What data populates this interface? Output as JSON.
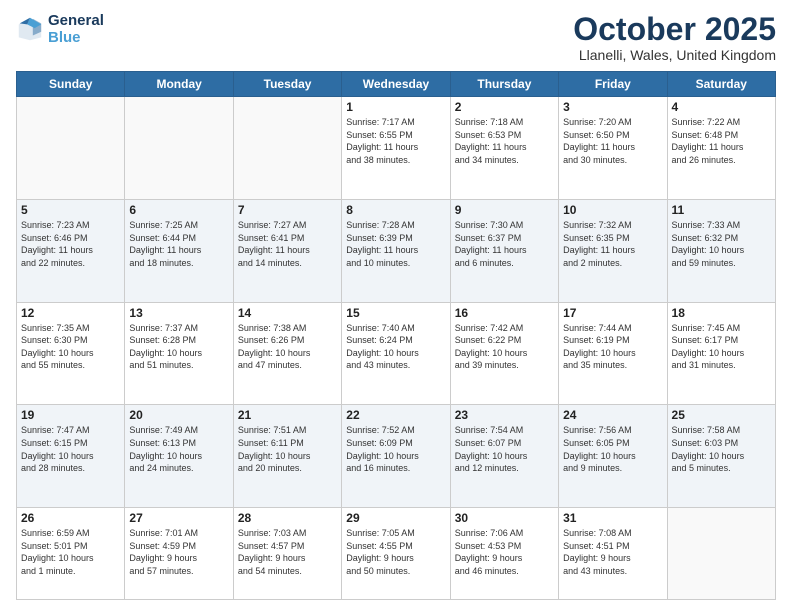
{
  "header": {
    "logo_line1": "General",
    "logo_line2": "Blue",
    "month": "October 2025",
    "location": "Llanelli, Wales, United Kingdom"
  },
  "weekdays": [
    "Sunday",
    "Monday",
    "Tuesday",
    "Wednesday",
    "Thursday",
    "Friday",
    "Saturday"
  ],
  "weeks": [
    [
      {
        "day": "",
        "info": ""
      },
      {
        "day": "",
        "info": ""
      },
      {
        "day": "",
        "info": ""
      },
      {
        "day": "1",
        "info": "Sunrise: 7:17 AM\nSunset: 6:55 PM\nDaylight: 11 hours\nand 38 minutes."
      },
      {
        "day": "2",
        "info": "Sunrise: 7:18 AM\nSunset: 6:53 PM\nDaylight: 11 hours\nand 34 minutes."
      },
      {
        "day": "3",
        "info": "Sunrise: 7:20 AM\nSunset: 6:50 PM\nDaylight: 11 hours\nand 30 minutes."
      },
      {
        "day": "4",
        "info": "Sunrise: 7:22 AM\nSunset: 6:48 PM\nDaylight: 11 hours\nand 26 minutes."
      }
    ],
    [
      {
        "day": "5",
        "info": "Sunrise: 7:23 AM\nSunset: 6:46 PM\nDaylight: 11 hours\nand 22 minutes."
      },
      {
        "day": "6",
        "info": "Sunrise: 7:25 AM\nSunset: 6:44 PM\nDaylight: 11 hours\nand 18 minutes."
      },
      {
        "day": "7",
        "info": "Sunrise: 7:27 AM\nSunset: 6:41 PM\nDaylight: 11 hours\nand 14 minutes."
      },
      {
        "day": "8",
        "info": "Sunrise: 7:28 AM\nSunset: 6:39 PM\nDaylight: 11 hours\nand 10 minutes."
      },
      {
        "day": "9",
        "info": "Sunrise: 7:30 AM\nSunset: 6:37 PM\nDaylight: 11 hours\nand 6 minutes."
      },
      {
        "day": "10",
        "info": "Sunrise: 7:32 AM\nSunset: 6:35 PM\nDaylight: 11 hours\nand 2 minutes."
      },
      {
        "day": "11",
        "info": "Sunrise: 7:33 AM\nSunset: 6:32 PM\nDaylight: 10 hours\nand 59 minutes."
      }
    ],
    [
      {
        "day": "12",
        "info": "Sunrise: 7:35 AM\nSunset: 6:30 PM\nDaylight: 10 hours\nand 55 minutes."
      },
      {
        "day": "13",
        "info": "Sunrise: 7:37 AM\nSunset: 6:28 PM\nDaylight: 10 hours\nand 51 minutes."
      },
      {
        "day": "14",
        "info": "Sunrise: 7:38 AM\nSunset: 6:26 PM\nDaylight: 10 hours\nand 47 minutes."
      },
      {
        "day": "15",
        "info": "Sunrise: 7:40 AM\nSunset: 6:24 PM\nDaylight: 10 hours\nand 43 minutes."
      },
      {
        "day": "16",
        "info": "Sunrise: 7:42 AM\nSunset: 6:22 PM\nDaylight: 10 hours\nand 39 minutes."
      },
      {
        "day": "17",
        "info": "Sunrise: 7:44 AM\nSunset: 6:19 PM\nDaylight: 10 hours\nand 35 minutes."
      },
      {
        "day": "18",
        "info": "Sunrise: 7:45 AM\nSunset: 6:17 PM\nDaylight: 10 hours\nand 31 minutes."
      }
    ],
    [
      {
        "day": "19",
        "info": "Sunrise: 7:47 AM\nSunset: 6:15 PM\nDaylight: 10 hours\nand 28 minutes."
      },
      {
        "day": "20",
        "info": "Sunrise: 7:49 AM\nSunset: 6:13 PM\nDaylight: 10 hours\nand 24 minutes."
      },
      {
        "day": "21",
        "info": "Sunrise: 7:51 AM\nSunset: 6:11 PM\nDaylight: 10 hours\nand 20 minutes."
      },
      {
        "day": "22",
        "info": "Sunrise: 7:52 AM\nSunset: 6:09 PM\nDaylight: 10 hours\nand 16 minutes."
      },
      {
        "day": "23",
        "info": "Sunrise: 7:54 AM\nSunset: 6:07 PM\nDaylight: 10 hours\nand 12 minutes."
      },
      {
        "day": "24",
        "info": "Sunrise: 7:56 AM\nSunset: 6:05 PM\nDaylight: 10 hours\nand 9 minutes."
      },
      {
        "day": "25",
        "info": "Sunrise: 7:58 AM\nSunset: 6:03 PM\nDaylight: 10 hours\nand 5 minutes."
      }
    ],
    [
      {
        "day": "26",
        "info": "Sunrise: 6:59 AM\nSunset: 5:01 PM\nDaylight: 10 hours\nand 1 minute."
      },
      {
        "day": "27",
        "info": "Sunrise: 7:01 AM\nSunset: 4:59 PM\nDaylight: 9 hours\nand 57 minutes."
      },
      {
        "day": "28",
        "info": "Sunrise: 7:03 AM\nSunset: 4:57 PM\nDaylight: 9 hours\nand 54 minutes."
      },
      {
        "day": "29",
        "info": "Sunrise: 7:05 AM\nSunset: 4:55 PM\nDaylight: 9 hours\nand 50 minutes."
      },
      {
        "day": "30",
        "info": "Sunrise: 7:06 AM\nSunset: 4:53 PM\nDaylight: 9 hours\nand 46 minutes."
      },
      {
        "day": "31",
        "info": "Sunrise: 7:08 AM\nSunset: 4:51 PM\nDaylight: 9 hours\nand 43 minutes."
      },
      {
        "day": "",
        "info": ""
      }
    ]
  ]
}
